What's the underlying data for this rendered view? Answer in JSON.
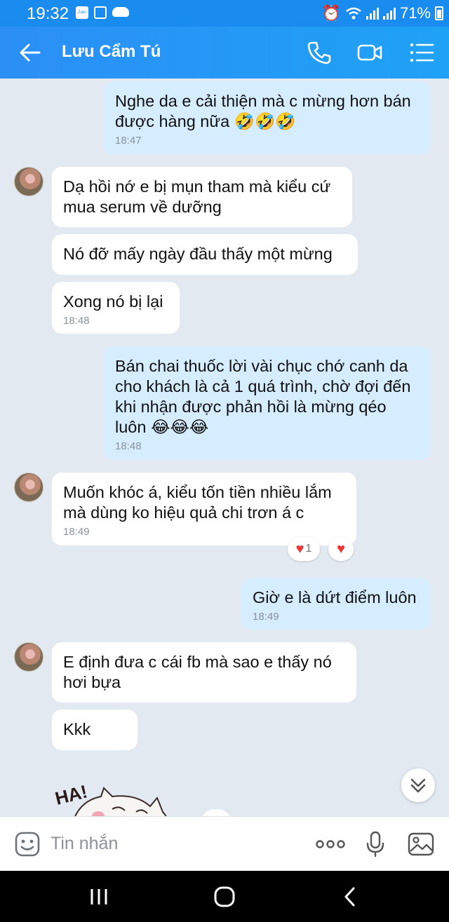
{
  "status_bar": {
    "time": "19:32",
    "zalo_label": "Zalo",
    "battery": "71%"
  },
  "header": {
    "contact_name": "Lưu Cẩm Tú"
  },
  "messages": [
    {
      "id": 1,
      "side": "out",
      "lines": [
        "Nghe da e cải thiện mà c mừng hơn bán",
        "được hàng nữa 🤣🤣🤣"
      ],
      "time": "18:47"
    },
    {
      "id": 2,
      "side": "in",
      "lines": [
        "Dạ hồi nớ e bị mụn tham mà kiểu cứ",
        "mua serum về dưỡng"
      ]
    },
    {
      "id": 3,
      "side": "in",
      "lines": [
        "Nó đỡ mấy ngày đầu thấy một mừng"
      ]
    },
    {
      "id": 4,
      "side": "in",
      "lines": [
        "Xong nó bị lại"
      ],
      "time": "18:48"
    },
    {
      "id": 5,
      "side": "out",
      "lines": [
        "Bán chai thuốc lời vài chục chớ canh da",
        "cho khách là cả 1 quá trình, chờ đợi đến",
        "khi nhận được phản hồi là mừng qéo",
        "luôn 😂😂😂"
      ],
      "time": "18:48"
    },
    {
      "id": 6,
      "side": "in",
      "lines": [
        "Muốn khóc á, kiểu tốn tiền nhiều lắm",
        "mà dùng ko hiệu quả chi trơn á c"
      ],
      "time": "18:49",
      "reaction_count": "1"
    },
    {
      "id": 7,
      "side": "out",
      "lines": [
        "Giờ e là dứt điểm luôn"
      ],
      "time": "18:49"
    },
    {
      "id": 8,
      "side": "in",
      "lines": [
        "E định đưa c cái fb mà sao e thấy nó",
        "hơi bựa"
      ]
    },
    {
      "id": 9,
      "side": "in",
      "lines": [
        "Kkk"
      ]
    }
  ],
  "sticker": {
    "text": "HA!"
  },
  "input": {
    "placeholder": "Tin nhắn"
  },
  "colors": {
    "header": "#1fa2f5",
    "chat_bg": "#e2e9f1",
    "outgoing": "#d5edff",
    "incoming": "#ffffff",
    "heart": "#e33333"
  }
}
